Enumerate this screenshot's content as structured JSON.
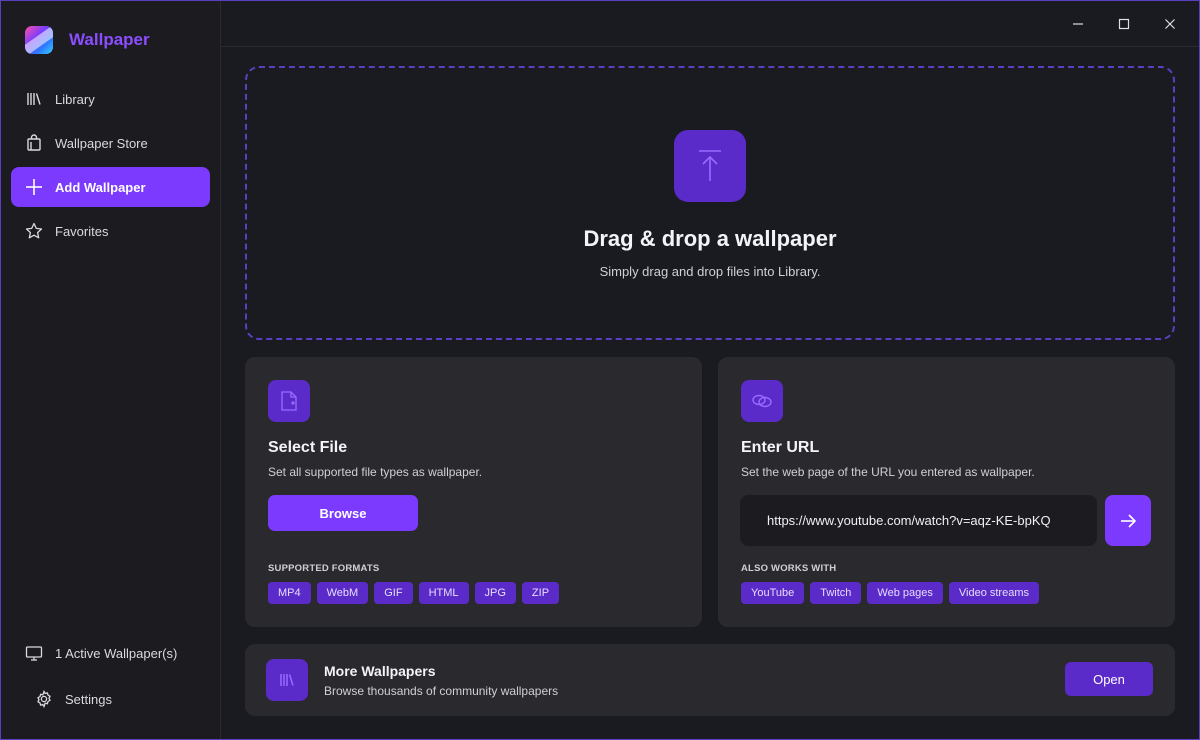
{
  "app": {
    "name": "Wallpaper"
  },
  "sidebar": {
    "items": [
      {
        "label": "Library",
        "icon": "library-icon"
      },
      {
        "label": "Wallpaper Store",
        "icon": "store-bag-icon"
      },
      {
        "label": "Add Wallpaper",
        "icon": "plus-icon",
        "active": true
      },
      {
        "label": "Favorites",
        "icon": "star-icon"
      }
    ],
    "status": "1 Active Wallpaper(s)",
    "settings": "Settings"
  },
  "dropzone": {
    "title": "Drag & drop a wallpaper",
    "subtitle": "Simply drag and drop files into Library."
  },
  "select_file": {
    "title": "Select File",
    "description": "Set all supported file types as wallpaper.",
    "button": "Browse",
    "formats_label": "SUPPORTED FORMATS",
    "formats": [
      "MP4",
      "WebM",
      "GIF",
      "HTML",
      "JPG",
      "ZIP"
    ]
  },
  "enter_url": {
    "title": "Enter URL",
    "description": "Set the web page of the URL you entered as wallpaper.",
    "url_value": "https://www.youtube.com/watch?v=aqz-KE-bpKQ",
    "also_label": "ALSO WORKS WITH",
    "sources": [
      "YouTube",
      "Twitch",
      "Web pages",
      "Video streams"
    ]
  },
  "more": {
    "title": "More Wallpapers",
    "description": "Browse thousands of community wallpapers",
    "button": "Open"
  },
  "colors": {
    "accent": "#7c3aff",
    "accent_dark": "#5b2bc9",
    "background": "#1a1b20",
    "card": "#2a2a2e"
  }
}
